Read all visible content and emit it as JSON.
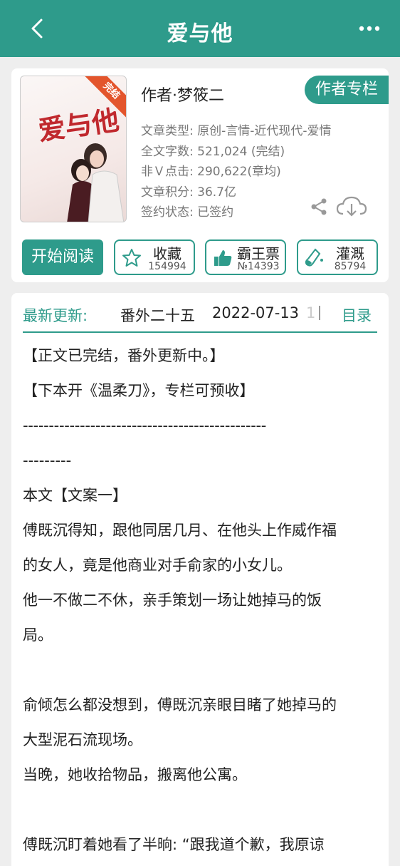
{
  "header": {
    "title": "爱与他",
    "back_icon": "chevron-left-icon",
    "more_icon": "more-dots-icon"
  },
  "book": {
    "cover_ribbon": "完结",
    "cover_title": "爱与他",
    "author": "作者·梦筱二",
    "author_column_button": "作者专栏",
    "meta": [
      "文章类型: 原创-言情-近代现代-爱情",
      "全文字数: 521,024 (完结)",
      "非Ｖ点击: 290,622(章均)",
      "文章积分: 36.7亿",
      "签约状态: 已签约"
    ]
  },
  "actions": {
    "read_button": "开始阅读",
    "collect": {
      "label": "收藏",
      "count": "154994",
      "icon": "star-icon"
    },
    "vote": {
      "label": "霸王票",
      "count": "№14393",
      "icon": "thumbs-up-icon"
    },
    "water": {
      "label": "灌溉",
      "count": "85794",
      "icon": "flask-icon"
    }
  },
  "latest": {
    "label": "最新更新:",
    "chapter": "番外二十五",
    "date": "2022-07-13",
    "faded": "1",
    "toc": "目录"
  },
  "content": [
    "【正文已完结，番外更新中。】",
    "【下本开《温柔刀》，专栏可预收】",
    "-----------------------------------------------",
    "---------",
    "本文【文案一】",
    "傅既沉得知，跟他同居几月、在他头上作威作福",
    "的女人，竟是他商业对手俞家的小女儿。",
    "他一不做二不休，亲手策划一场让她掉马的饭",
    "局。",
    "",
    "俞倾怎么都没想到，傅既沉亲眼目睹了她掉马的",
    "大型泥石流现场。",
    "当晚，她收拾物品，搬离他公寓。",
    "",
    "傅既沉盯着她看了半晌: “跟我道个歉，我原谅"
  ],
  "colors": {
    "accent": "#2e9b8b",
    "ribbon": "#e3552c"
  }
}
